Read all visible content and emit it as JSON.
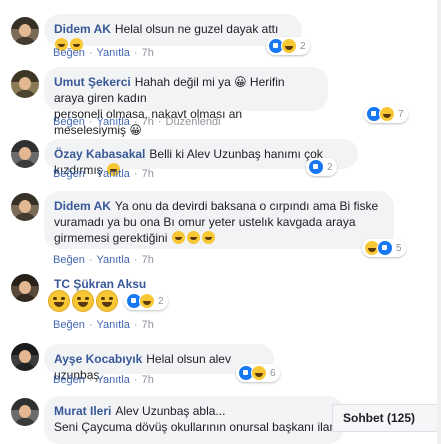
{
  "comments": [
    {
      "author": "Didem AK",
      "text": "Helal olsun ne guzel dayak attı",
      "emoji": "🤣🤣",
      "like_label": "Beğen",
      "reply_label": "Yanıtla",
      "time": "7h",
      "reaction_count": "2"
    },
    {
      "author": "Umut Şekerci",
      "text_line1": "Hahah değil mi ya 😀 Herifin araya giren kadın",
      "text_line2": "personeli olmasa, nakavt olması an meselesiymiş 😀",
      "like_label": "Beğen",
      "reply_label": "Yanıtla",
      "time": "7h",
      "edited_label": "Düzenlendi",
      "reaction_count": "7"
    },
    {
      "author": "Özay Kabasakal",
      "text": "Belli ki Alev Uzunbaş hanımı çok kızdırmış",
      "like_label": "Beğen",
      "reply_label": "Yanıtla",
      "time": "7h",
      "reaction_count": "2"
    },
    {
      "author": "Didem AK",
      "text_line1": "Ya onu da devirdi baksana o cırpındı ama Bi fiske",
      "text_line2": "vuramadı ya bu ona Bı omur yeter ustelık kavgada araya",
      "text_line3": "girmemesi gerektiğini",
      "like_label": "Beğen",
      "reply_label": "Yanıtla",
      "time": "7h",
      "reaction_count": "5"
    },
    {
      "author": "TC Şükran Aksu",
      "like_label": "Beğen",
      "reply_label": "Yanıtla",
      "time": "7h",
      "reaction_count": "2"
    },
    {
      "author": "Ayşe Kocabıyık",
      "text": "Helal olsun alev uzunbaş..",
      "like_label": "Beğen",
      "reply_label": "Yanıtla",
      "time": "7h",
      "reaction_count": "6"
    },
    {
      "author": "Murat Ileri",
      "text_line1": "Alev Uzunbaş abla...",
      "text_line2": "Seni Çaycuma dövüş okullarının onursal başkanı ilan ed"
    }
  ],
  "chat": {
    "label": "Sohbet (125)"
  },
  "colors": {
    "link": "#385898",
    "bubble": "#f2f3f5",
    "like": "#1877f2",
    "haha": "#f7c833"
  }
}
